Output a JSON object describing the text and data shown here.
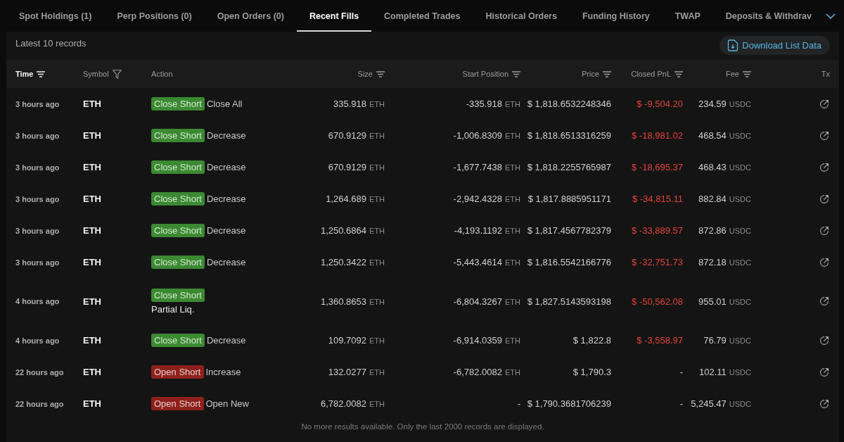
{
  "tabs": [
    {
      "label": "Spot Holdings (1)",
      "selected": false
    },
    {
      "label": "Perp Positions (0)",
      "selected": false
    },
    {
      "label": "Open Orders (0)",
      "selected": false
    },
    {
      "label": "Recent Fills",
      "selected": true
    },
    {
      "label": "Completed Trades",
      "selected": false
    },
    {
      "label": "Historical Orders",
      "selected": false
    },
    {
      "label": "Funding History",
      "selected": false
    },
    {
      "label": "TWAP",
      "selected": false
    },
    {
      "label": "Deposits & Withdrav",
      "selected": false
    }
  ],
  "records_label": "Latest 10 records",
  "download_button": {
    "label": "Download List Data"
  },
  "table": {
    "columns": [
      {
        "label": "Time",
        "kind": "sort",
        "selected": true
      },
      {
        "label": "Symbol",
        "kind": "filter",
        "selected": false
      },
      {
        "label": "Action",
        "kind": "plain",
        "selected": false
      },
      {
        "label": "Size",
        "kind": "sort",
        "selected": false
      },
      {
        "label": "Start Position",
        "kind": "sort",
        "selected": false
      },
      {
        "label": "Price",
        "kind": "sort",
        "selected": false
      },
      {
        "label": "Closed PnL",
        "kind": "sort",
        "selected": false
      },
      {
        "label": "Fee",
        "kind": "sort",
        "selected": false
      },
      {
        "label": "Tx",
        "kind": "plain",
        "selected": false
      }
    ],
    "rows": [
      {
        "time": "3 hours ago",
        "symbol": "ETH",
        "action": {
          "badge": "Close Short",
          "color": "#3b8a32",
          "detail": "Close All",
          "kind": "inline"
        },
        "size": {
          "value": "335.918",
          "unit": "ETH"
        },
        "start_position": {
          "value": "-335.918",
          "unit": "ETH"
        },
        "price": "$ 1,818.6532248346",
        "closed_pnl": {
          "value": "$ -9,504.20",
          "loss": true
        },
        "fee": {
          "value": "234.59",
          "unit": "USDC"
        }
      },
      {
        "time": "3 hours ago",
        "symbol": "ETH",
        "action": {
          "badge": "Close Short",
          "color": "#3b8a32",
          "detail": "Decrease",
          "kind": "inline"
        },
        "size": {
          "value": "670.9129",
          "unit": "ETH"
        },
        "start_position": {
          "value": "-1,006.8309",
          "unit": "ETH"
        },
        "price": "$ 1,818.6513316259",
        "closed_pnl": {
          "value": "$ -18,981.02",
          "loss": true
        },
        "fee": {
          "value": "468.54",
          "unit": "USDC"
        }
      },
      {
        "time": "3 hours ago",
        "symbol": "ETH",
        "action": {
          "badge": "Close Short",
          "color": "#3b8a32",
          "detail": "Decrease",
          "kind": "inline"
        },
        "size": {
          "value": "670.9129",
          "unit": "ETH"
        },
        "start_position": {
          "value": "-1,677.7438",
          "unit": "ETH"
        },
        "price": "$ 1,818.2255765987",
        "closed_pnl": {
          "value": "$ -18,695.37",
          "loss": true
        },
        "fee": {
          "value": "468.43",
          "unit": "USDC"
        }
      },
      {
        "time": "3 hours ago",
        "symbol": "ETH",
        "action": {
          "badge": "Close Short",
          "color": "#3b8a32",
          "detail": "Decrease",
          "kind": "inline"
        },
        "size": {
          "value": "1,264.689",
          "unit": "ETH"
        },
        "start_position": {
          "value": "-2,942.4328",
          "unit": "ETH"
        },
        "price": "$ 1,817.8885951171",
        "closed_pnl": {
          "value": "$ -34,815.11",
          "loss": true
        },
        "fee": {
          "value": "882.84",
          "unit": "USDC"
        }
      },
      {
        "time": "3 hours ago",
        "symbol": "ETH",
        "action": {
          "badge": "Close Short",
          "color": "#3b8a32",
          "detail": "Decrease",
          "kind": "inline"
        },
        "size": {
          "value": "1,250.6864",
          "unit": "ETH"
        },
        "start_position": {
          "value": "-4,193.1192",
          "unit": "ETH"
        },
        "price": "$ 1,817.4567782379",
        "closed_pnl": {
          "value": "$ -33,889.57",
          "loss": true
        },
        "fee": {
          "value": "872.86",
          "unit": "USDC"
        }
      },
      {
        "time": "3 hours ago",
        "symbol": "ETH",
        "action": {
          "badge": "Close Short",
          "color": "#3b8a32",
          "detail": "Decrease",
          "kind": "inline"
        },
        "size": {
          "value": "1,250.3422",
          "unit": "ETH"
        },
        "start_position": {
          "value": "-5,443.4614",
          "unit": "ETH"
        },
        "price": "$ 1,816.5542166776",
        "closed_pnl": {
          "value": "$ -32,751.73",
          "loss": true
        },
        "fee": {
          "value": "872.18",
          "unit": "USDC"
        }
      },
      {
        "time": "4 hours ago",
        "symbol": "ETH",
        "action": {
          "badge": "Close Short",
          "color": "#3b8a32",
          "detail": "Partial Liq.",
          "kind": "stacked"
        },
        "size": {
          "value": "1,360.8653",
          "unit": "ETH"
        },
        "start_position": {
          "value": "-6,804.3267",
          "unit": "ETH"
        },
        "price": "$ 1,827.5143593198",
        "closed_pnl": {
          "value": "$ -50,562.08",
          "loss": true
        },
        "fee": {
          "value": "955.01",
          "unit": "USDC"
        }
      },
      {
        "time": "4 hours ago",
        "symbol": "ETH",
        "action": {
          "badge": "Close Short",
          "color": "#3b8a32",
          "detail": "Decrease",
          "kind": "inline"
        },
        "size": {
          "value": "109.7092",
          "unit": "ETH"
        },
        "start_position": {
          "value": "-6,914.0359",
          "unit": "ETH"
        },
        "price": "$ 1,822.8",
        "closed_pnl": {
          "value": "$ -3,558.97",
          "loss": true
        },
        "fee": {
          "value": "76.79",
          "unit": "USDC"
        }
      },
      {
        "time": "22 hours ago",
        "symbol": "ETH",
        "action": {
          "badge": "Open Short",
          "color": "#8e201b",
          "detail": "Increase",
          "kind": "inline"
        },
        "size": {
          "value": "132.0277",
          "unit": "ETH"
        },
        "start_position": {
          "value": "-6,782.0082",
          "unit": "ETH"
        },
        "price": "$ 1,790.3",
        "closed_pnl": {
          "value": "-",
          "loss": false
        },
        "fee": {
          "value": "102.11",
          "unit": "USDC"
        }
      },
      {
        "time": "22 hours ago",
        "symbol": "ETH",
        "action": {
          "badge": "Open Short",
          "color": "#8e201b",
          "detail": "Open New",
          "kind": "inline"
        },
        "size": {
          "value": "6,782.0082",
          "unit": "ETH"
        },
        "start_position": {
          "value": "-"
        },
        "price": "$ 1,790.3681706239",
        "closed_pnl": {
          "value": "-",
          "loss": false
        },
        "fee": {
          "value": "5,245.47",
          "unit": "USDC"
        }
      }
    ],
    "footer_note": "No more results available. Only the last 2000 records are displayed."
  }
}
